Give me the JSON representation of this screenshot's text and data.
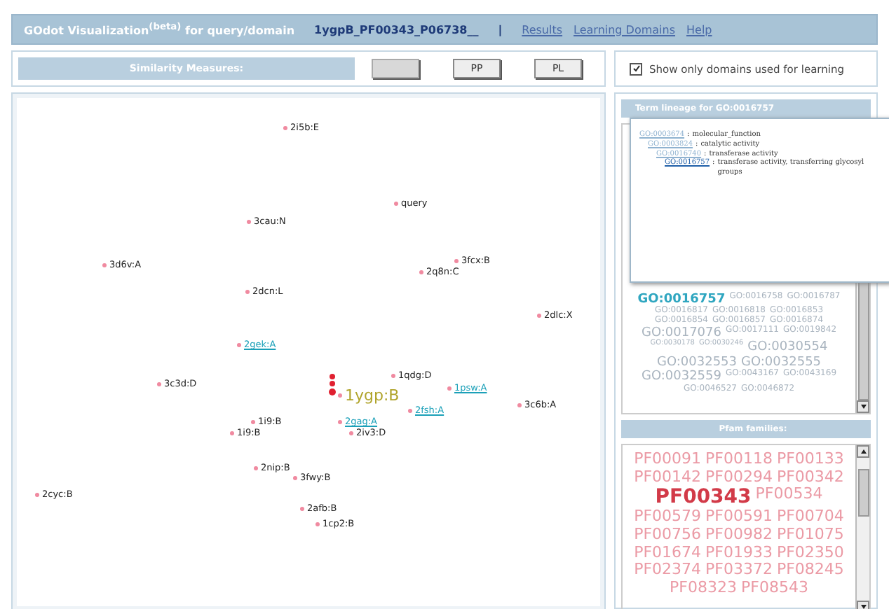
{
  "header": {
    "title": "GOdot Visualization$^{(beta)}$ for query/domain",
    "domain": "1ygpB_PF00343_P06738__",
    "separator": "|",
    "links": [
      "Results",
      "Learning Domains",
      "Help"
    ]
  },
  "similarity": {
    "label": "Similarity Measures:",
    "buttons": [
      {
        "selected": true
      },
      {
        "label": "PP",
        "selected": false
      },
      {
        "label": "PL",
        "selected": false
      }
    ]
  },
  "filter": {
    "label": "Show only domains used for learning",
    "checked": true
  },
  "plot": {
    "nodes": [
      {
        "label": "2i5b:E",
        "kind": "plain"
      },
      {
        "label": "query",
        "kind": "plain"
      },
      {
        "label": "3cau:N",
        "kind": "plain"
      },
      {
        "label": "3d6v:A",
        "kind": "plain"
      },
      {
        "label": "3fcx:B",
        "kind": "plain"
      },
      {
        "label": "2q8n:C",
        "kind": "plain"
      },
      {
        "label": "2dcn:L",
        "kind": "plain"
      },
      {
        "label": "2dlc:X",
        "kind": "plain"
      },
      {
        "label": "2gek:A",
        "kind": "learning"
      },
      {
        "label": "3c3d:D",
        "kind": "plain"
      },
      {
        "label": "1qdg:D",
        "kind": "plain"
      },
      {
        "label": "1psw:A",
        "kind": "learning"
      },
      {
        "label": "3c6b:A",
        "kind": "plain"
      },
      {
        "label": "1ygp:B",
        "kind": "target"
      },
      {
        "label": "2fsh:A",
        "kind": "learning"
      },
      {
        "label": "1i9:B",
        "kind": "plain"
      },
      {
        "label": "1i9:B",
        "kind": "plain"
      },
      {
        "label": "2gag:A",
        "kind": "learning"
      },
      {
        "label": "2iv3:D",
        "kind": "plain"
      },
      {
        "label": "2nip:B",
        "kind": "plain"
      },
      {
        "label": "3fwy:B",
        "kind": "plain"
      },
      {
        "label": "2cyc:B",
        "kind": "plain"
      },
      {
        "label": "2afb:B",
        "kind": "plain"
      },
      {
        "label": "1cp2:B",
        "kind": "plain"
      }
    ]
  },
  "go_panel": {
    "title": "Term lineage for GO:0016757",
    "separator": ":",
    "lineage": [
      {
        "term": "GO:0003674",
        "name": "molecular_function",
        "selected": false,
        "children": [
          {
            "term": "GO:0003824",
            "name": "catalytic activity",
            "selected": false,
            "children": [
              {
                "term": "GO:0016740",
                "name": "transferase activity",
                "selected": false,
                "children": [
                  {
                    "term": "GO:0016757",
                    "name": "transferase activity, transferring glycosyl groups",
                    "selected": true
                  }
                ]
              }
            ]
          }
        ]
      }
    ],
    "terms": [
      {
        "label": "GO:0016757",
        "kind": "large",
        "selected": true
      },
      {
        "label": "GO:0016758",
        "kind": "medium",
        "selected": false
      },
      {
        "label": "GO:0016787",
        "kind": "medium",
        "selected": false
      },
      {
        "label": "GO:0016817",
        "kind": "medium",
        "selected": false
      },
      {
        "label": "GO:0016818",
        "kind": "medium",
        "selected": false
      },
      {
        "label": "GO:0016853",
        "kind": "medium",
        "selected": false
      },
      {
        "label": "GO:0016854",
        "kind": "medium",
        "selected": false
      },
      {
        "label": "GO:0016857",
        "kind": "medium",
        "selected": false
      },
      {
        "label": "GO:0016874",
        "kind": "medium",
        "selected": false
      },
      {
        "label": "GO:0017076",
        "kind": "large",
        "selected": false
      },
      {
        "label": "GO:0017111",
        "kind": "medium",
        "selected": false
      },
      {
        "label": "GO:0019842",
        "kind": "medium",
        "selected": false
      },
      {
        "label": "GO:0030178",
        "kind": "small",
        "selected": false
      },
      {
        "label": "GO:0030246",
        "kind": "small",
        "selected": false
      },
      {
        "label": "GO:0030554",
        "kind": "large",
        "selected": false
      },
      {
        "label": "GO:0032553",
        "kind": "large",
        "selected": false
      },
      {
        "label": "GO:0032555",
        "kind": "large",
        "selected": false
      },
      {
        "label": "GO:0032559",
        "kind": "large",
        "selected": false
      },
      {
        "label": "GO:0043167",
        "kind": "medium",
        "selected": false
      },
      {
        "label": "GO:0043169",
        "kind": "medium",
        "selected": false
      },
      {
        "label": "GO:0046527",
        "kind": "medium",
        "selected": false
      },
      {
        "label": "GO:0046872",
        "kind": "medium",
        "selected": false
      }
    ]
  },
  "pfam_panel": {
    "title": "Pfam families:",
    "families": [
      {
        "label": "PF00091",
        "selected": false
      },
      {
        "label": "PF00118",
        "selected": false
      },
      {
        "label": "PF00133",
        "selected": false
      },
      {
        "label": "PF00142",
        "selected": false
      },
      {
        "label": "PF00294",
        "selected": false
      },
      {
        "label": "PF00342",
        "selected": false
      },
      {
        "label": "PF00343",
        "selected": true
      },
      {
        "label": "PF00534",
        "selected": false
      },
      {
        "label": "PF00579",
        "selected": false
      },
      {
        "label": "PF00591",
        "selected": false
      },
      {
        "label": "PF00704",
        "selected": false
      },
      {
        "label": "PF00756",
        "selected": false
      },
      {
        "label": "PF00982",
        "selected": false
      },
      {
        "label": "PF01075",
        "selected": false
      },
      {
        "label": "PF01674",
        "selected": false
      },
      {
        "label": "PF01933",
        "selected": false
      },
      {
        "label": "PF02350",
        "selected": false
      },
      {
        "label": "PF02374",
        "selected": false
      },
      {
        "label": "PF03372",
        "selected": false
      },
      {
        "label": "PF08245",
        "selected": false
      },
      {
        "label": "PF08323",
        "selected": false
      },
      {
        "label": "PF08543",
        "selected": false
      }
    ]
  }
}
